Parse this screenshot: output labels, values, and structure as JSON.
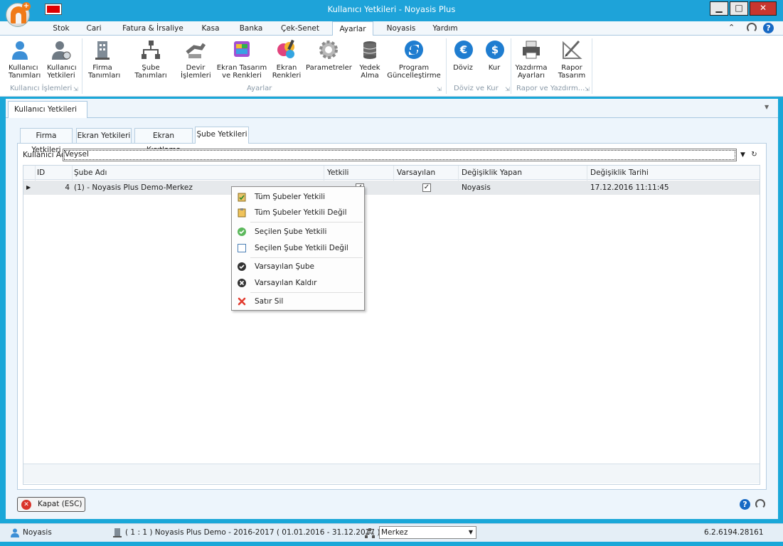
{
  "window": {
    "title": "Kullanıcı Yetkileri - Noyasis Plus",
    "minimize": "▁",
    "maximize": "□",
    "close": "✕"
  },
  "menu": {
    "tabs": [
      "Stok",
      "Cari",
      "Fatura & İrsaliye",
      "Kasa",
      "Banka",
      "Çek-Senet",
      "Ayarlar",
      "Noyasis",
      "Yardım"
    ],
    "active": "Ayarlar"
  },
  "ribbon": {
    "buttons": [
      {
        "label1": "Kullanıcı",
        "label2": "Tanımları",
        "icon": "user-icon"
      },
      {
        "label1": "Kullanıcı",
        "label2": "Yetkileri",
        "icon": "user-key-icon"
      },
      {
        "label1": "Firma",
        "label2": "Tanımları",
        "icon": "building-icon"
      },
      {
        "label1": "Şube Tanımları",
        "label2": "",
        "icon": "branch-tree-icon"
      },
      {
        "label1": "Devir",
        "label2": "İşlemleri",
        "icon": "transfer-icon"
      },
      {
        "label1": "Ekran Tasarım",
        "label2": "ve Renkleri",
        "icon": "screen-design-icon"
      },
      {
        "label1": "Ekran",
        "label2": "Renkleri",
        "icon": "palette-icon"
      },
      {
        "label1": "Parametreler",
        "label2": "",
        "icon": "gear-icon"
      },
      {
        "label1": "Yedek",
        "label2": "Alma",
        "icon": "database-icon"
      },
      {
        "label1": "Program",
        "label2": "Güncelleştirme",
        "icon": "refresh-icon"
      },
      {
        "label1": "Döviz",
        "label2": "",
        "icon": "euro-icon"
      },
      {
        "label1": "Kur",
        "label2": "",
        "icon": "dollar-icon"
      },
      {
        "label1": "Yazdırma",
        "label2": "Ayarları",
        "icon": "printer-icon"
      },
      {
        "label1": "Rapor",
        "label2": "Tasarım",
        "icon": "report-design-icon"
      }
    ],
    "groups": [
      "Kullanıcı İşlemleri",
      "Ayarlar",
      "Döviz ve Kur",
      "Rapor ve Yazdırm..."
    ]
  },
  "doc_tab": {
    "label": "Kullanıcı Yetkileri",
    "close": "✕"
  },
  "sub_tabs": [
    "Firma Yetkileri",
    "Ekran Yetkileri",
    "Ekran Kısıtlama",
    "Şube Yetkileri"
  ],
  "active_sub_tab": "Şube Yetkileri",
  "user": {
    "label": "Kullanıcı Adı",
    "value": "Veysel"
  },
  "grid": {
    "columns": [
      "ID",
      "Şube Adı",
      "Yetkili",
      "Varsayılan",
      "Değişiklik Yapan",
      "Değişiklik Tarihi"
    ],
    "rows": [
      {
        "id": "4",
        "sube_adi": "(1) - Noyasis Plus Demo-Merkez",
        "yetkili": true,
        "varsayilan": true,
        "degisiklik_yapan": "Noyasis",
        "degisiklik_tarihi": "17.12.2016 11:11:45"
      }
    ]
  },
  "context_menu": [
    {
      "label": "Tüm Şubeler Yetkili",
      "icon": "clipboard-check-icon"
    },
    {
      "label": "Tüm Şubeler Yetkili Değil",
      "icon": "clipboard-icon"
    },
    {
      "label": "Seçilen Şube Yetkili",
      "icon": "check-circle-icon"
    },
    {
      "label": "Seçilen Şube Yetkili Değil",
      "icon": "empty-box-icon"
    },
    {
      "label": "Varsayılan Şube",
      "icon": "check-dark-icon"
    },
    {
      "label": "Varsayılan Kaldır",
      "icon": "x-dark-icon"
    },
    {
      "label": "Satır Sil",
      "icon": "delete-x-icon"
    }
  ],
  "close_button": "Kapat (ESC)",
  "status": {
    "user": "Noyasis",
    "company": "( 1 : 1 )  Noyasis Plus Demo - 2016-2017  ( 01.01.2016 - 31.12.2017 )",
    "branch": "Merkez",
    "version": "6.2.6194.28161"
  },
  "colors": {
    "accent": "#1ea3d9",
    "brand_orange": "#f07a17",
    "close_red": "#c8362f"
  }
}
